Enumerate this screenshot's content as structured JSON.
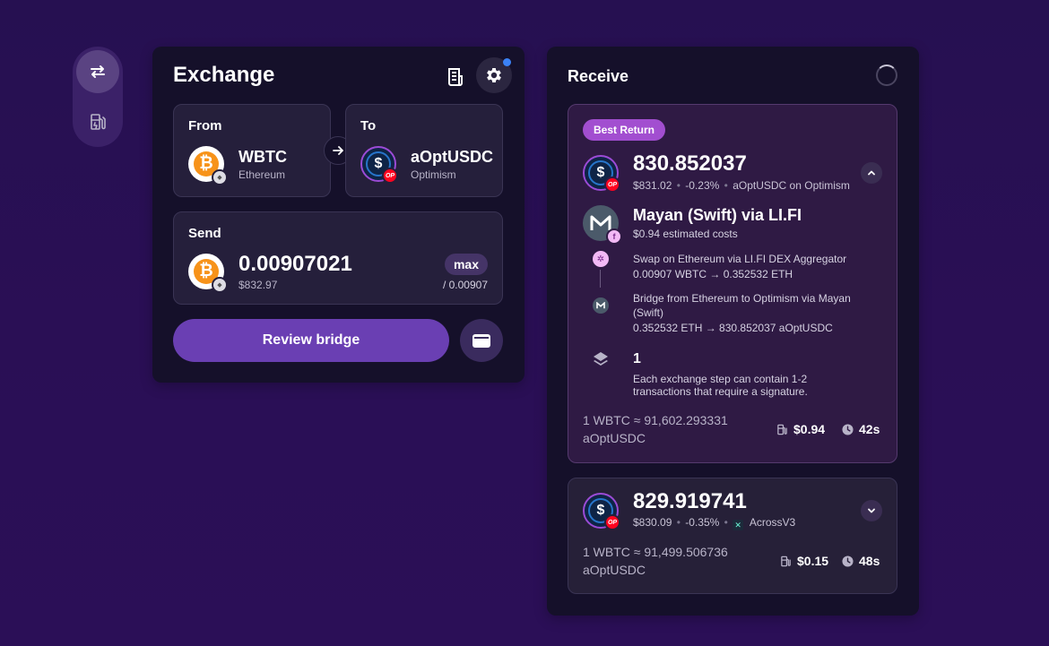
{
  "colors": {
    "accent": "#6a3fb3",
    "best_badge": "#a24ed0",
    "notification": "#3b82f6"
  },
  "side_nav": {
    "items": [
      {
        "icon": "swap-arrows-icon"
      },
      {
        "icon": "gas-pump-icon"
      }
    ]
  },
  "exchange": {
    "title": "Exchange",
    "from": {
      "label": "From",
      "token": "WBTC",
      "chain": "Ethereum"
    },
    "to": {
      "label": "To",
      "token": "aOptUSDC",
      "chain": "Optimism"
    },
    "send": {
      "label": "Send",
      "amount": "0.00907021",
      "usd": "$832.97",
      "max_label": "max",
      "balance": "/ 0.00907"
    },
    "review_label": "Review bridge"
  },
  "receive": {
    "title": "Receive",
    "best": {
      "badge": "Best Return",
      "amount": "830.852037",
      "usd": "$831.02",
      "change": "-0.23%",
      "dest": "aOptUSDC on Optimism",
      "provider": "Mayan (Swift) via LI.FI",
      "provider_cost": "$0.94 estimated costs",
      "steps": [
        {
          "title": "Swap on Ethereum via LI.FI DEX Aggregator",
          "detail": "0.00907 WBTC → 0.352532 ETH"
        },
        {
          "title": "Bridge from Ethereum to Optimism via Mayan (Swift)",
          "detail": "0.352532 ETH → 830.852037 aOptUSDC"
        }
      ],
      "tx_count": "1",
      "tx_note": "Each exchange step can contain 1-2 transactions that require a signature.",
      "rate": "1 WBTC ≈ 91,602.293331 aOptUSDC",
      "gas": "$0.94",
      "time": "42s"
    },
    "alt": {
      "amount": "829.919741",
      "usd": "$830.09",
      "change": "-0.35%",
      "provider": "AcrossV3",
      "rate": "1 WBTC ≈ 91,499.506736 aOptUSDC",
      "gas": "$0.15",
      "time": "48s"
    }
  }
}
